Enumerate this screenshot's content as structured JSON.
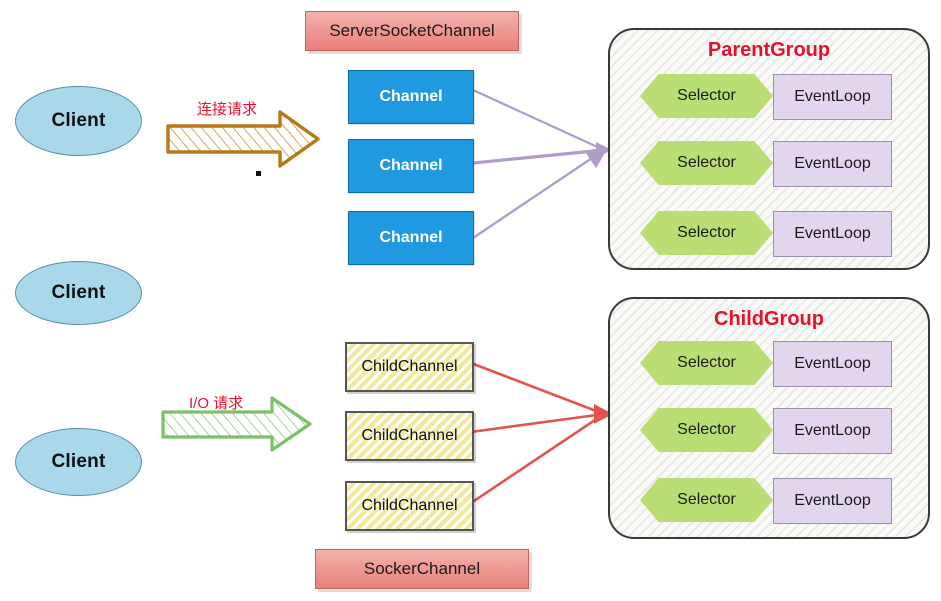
{
  "diagram": {
    "title": "Netty ParentGroup / ChildGroup reactor diagram",
    "colors": {
      "client_fill": "#a8d8ea",
      "channel_fill": "#1f9ae0",
      "childchannel_fill": "#fbf7c0",
      "plate_fill": "#ef9d98",
      "group_title": "#e8112d",
      "selector_fill": "#bade73",
      "eventloop_fill": "#e2d5ee",
      "connect_arrow": "#b58a2e",
      "io_arrow": "#7fbf6a",
      "parent_link": "#b09cc9",
      "child_link": "#e2554f"
    },
    "clients": [
      {
        "label": "Client"
      },
      {
        "label": "Client"
      },
      {
        "label": "Client"
      }
    ],
    "flows": [
      {
        "name": "connect-request",
        "label": "连接请求",
        "arrow_color": "#b58a2e"
      },
      {
        "name": "io-request",
        "label": "I/O 请求",
        "arrow_color": "#7fbf6a"
      }
    ],
    "plates": [
      {
        "name": "server-socket-channel",
        "label": "ServerSocketChannel"
      },
      {
        "name": "socker-channel",
        "label": "SockerChannel"
      }
    ],
    "channels": [
      {
        "label": "Channel"
      },
      {
        "label": "Channel"
      },
      {
        "label": "Channel"
      }
    ],
    "child_channels": [
      {
        "label": "ChildChannel"
      },
      {
        "label": "ChildChannel"
      },
      {
        "label": "ChildChannel"
      }
    ],
    "groups": [
      {
        "name": "parent-group",
        "title": "ParentGroup",
        "rows": [
          {
            "selector": "Selector",
            "eventloop": "EventLoop"
          },
          {
            "selector": "Selector",
            "eventloop": "EventLoop"
          },
          {
            "selector": "Selector",
            "eventloop": "EventLoop"
          }
        ]
      },
      {
        "name": "child-group",
        "title": "ChildGroup",
        "rows": [
          {
            "selector": "Selector",
            "eventloop": "EventLoop"
          },
          {
            "selector": "Selector",
            "eventloop": "EventLoop"
          },
          {
            "selector": "Selector",
            "eventloop": "EventLoop"
          }
        ]
      }
    ]
  }
}
